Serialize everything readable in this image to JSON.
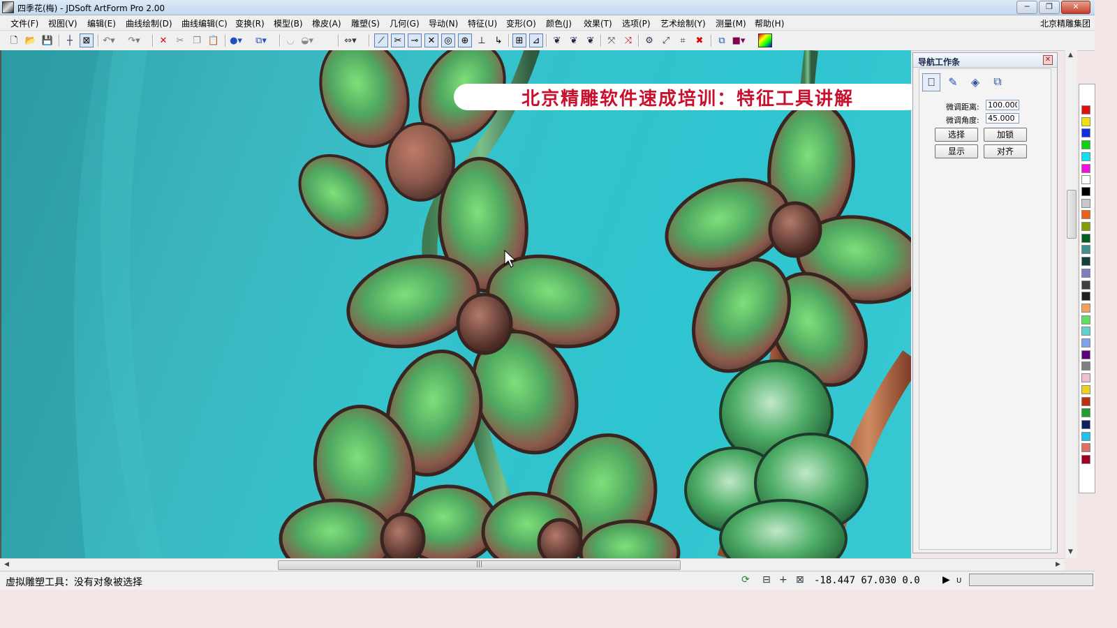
{
  "window": {
    "title": "四季花(梅) - JDSoft ArtForm Pro 2.00",
    "buttons": {
      "minimize": "─",
      "restore": "❐",
      "close": "✕"
    }
  },
  "menubar": {
    "items": [
      "文件(F)",
      "视图(V)",
      "编辑(E)",
      "曲线绘制(D)",
      "曲线编辑(C)",
      "变换(R)",
      "模型(B)",
      "橡皮(A)",
      "雕塑(S)",
      "几何(G)",
      "导动(N)",
      "特征(U)",
      "变形(O)",
      "颜色(J)",
      "效果(T)",
      "选项(P)",
      "艺术绘制(Y)",
      "测量(M)",
      "帮助(H)"
    ],
    "company": "北京精雕集团"
  },
  "toolbar": {
    "icons": [
      "new-file-icon",
      "open-folder-icon",
      "save-icon",
      "crosshair-icon",
      "fit-view-icon",
      "undo-icon",
      "redo-icon",
      "delete-icon",
      "cut-icon",
      "copy-icon",
      "paste-icon",
      "sphere-icon",
      "cube-icon",
      "bowl-icon",
      "bowl-solid-icon",
      "drag-icon",
      "line-tool-icon",
      "trim-tool-icon",
      "extend-tool-icon",
      "cross-tool-icon",
      "circle-tool-icon",
      "target-tool-icon",
      "perpendicular-tool-icon",
      "hook-tool-icon",
      "grid-snap-icon",
      "graph-tool-icon",
      "sculpt-1-icon",
      "sculpt-2-icon",
      "sculpt-3-icon",
      "curve-edit-icon",
      "curve-delete-icon",
      "shape-1-icon",
      "shape-2-icon",
      "shape-3-icon",
      "close-red-icon",
      "layers-icon",
      "color-swatch-icon",
      "gradient-icon"
    ]
  },
  "overlay": {
    "banner_text": "北京精雕软件速成培训：特征工具讲解"
  },
  "nav_panel": {
    "title": "导航工作条",
    "fine_distance_label": "微调距离:",
    "fine_distance_value": "100.000",
    "fine_angle_label": "微调角度:",
    "fine_angle_value": "45.000",
    "buttons": {
      "select": "选择",
      "lock": "加锁",
      "show": "显示",
      "align": "对齐"
    }
  },
  "palette": {
    "colors": [
      "#e01010",
      "#f0e010",
      "#1030e0",
      "#10d010",
      "#10e0f0",
      "#f010e0",
      "#ffffff",
      "#000000",
      "#c8c8c8",
      "#f06010",
      "#80a000",
      "#006020",
      "#409090",
      "#104040",
      "#8080c0",
      "#404040",
      "#202020",
      "#f0a060",
      "#60e060",
      "#60d0d0",
      "#80a0f0",
      "#600080",
      "#808080",
      "#f0c0d0",
      "#f0d020",
      "#c03010",
      "#20a030",
      "#102060",
      "#20c0f0",
      "#e07060",
      "#a00020"
    ]
  },
  "statusbar": {
    "message": "虚拟雕塑工具：没有对象被选择",
    "coordinates": "-18.447  67.030  0.0",
    "unit_marker": "U"
  },
  "colors": {
    "canvas_bg": "#35c2cb",
    "banner_text": "#c8102e",
    "petal": "#8a5a4c",
    "leaf": "#3fa85a"
  }
}
